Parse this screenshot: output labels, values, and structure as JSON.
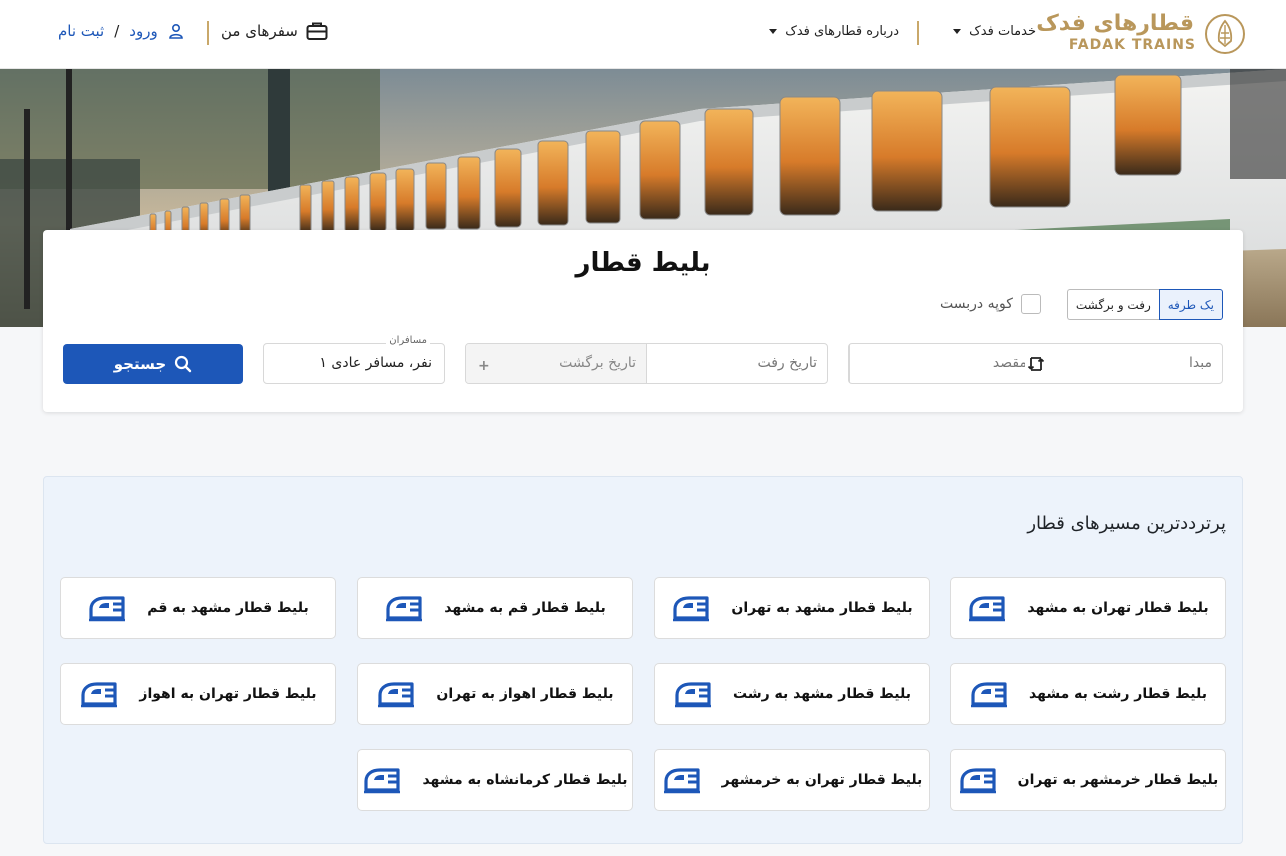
{
  "header": {
    "logo_fa": "قطارهای فدک",
    "logo_en": "FADAK TRAINS",
    "nav": [
      {
        "label": "خدمات فدک"
      },
      {
        "label": "درباره قطارهای فدک"
      }
    ],
    "my_trips": "سفرهای من",
    "login": "ورود",
    "login_separator": "/",
    "register": "ثبت نام"
  },
  "search": {
    "title": "بلیط قطار",
    "trip_types": [
      "یک طرفه",
      "رفت و برگشت"
    ],
    "selected_trip_type": "یک طرفه",
    "coupe_label": "کوپه دربست",
    "origin_placeholder": "مبدا",
    "destination_placeholder": "مقصد",
    "depart_placeholder": "تاریخ رفت",
    "return_placeholder": "تاریخ برگشت",
    "passengers_label": "مسافران",
    "passengers_value": "۱ نفر، مسافر عادی",
    "search_button": "جستجو"
  },
  "popular": {
    "title": "پرترددترین مسیرهای قطار",
    "routes": [
      "بلیط قطار تهران به مشهد",
      "بلیط قطار مشهد به تهران",
      "بلیط قطار قم به مشهد",
      "بلیط قطار مشهد به قم",
      "بلیط قطار رشت به مشهد",
      "بلیط قطار مشهد به رشت",
      "بلیط قطار اهواز به تهران",
      "بلیط قطار تهران به اهواز",
      "بلیط قطار خرمشهر به تهران",
      "بلیط قطار تهران به خرمشهر",
      "بلیط قطار کرمانشاه به مشهد"
    ]
  },
  "colors": {
    "accent": "#1d57b8",
    "gold": "#b9975b",
    "panel": "#edf3fb"
  },
  "icons": {
    "train_icon": "train-front-icon",
    "user_icon": "user-icon",
    "briefcase_icon": "briefcase-icon",
    "search_icon": "search-icon",
    "swap_icon": "swap-icon",
    "plus_icon": "plus-icon"
  }
}
